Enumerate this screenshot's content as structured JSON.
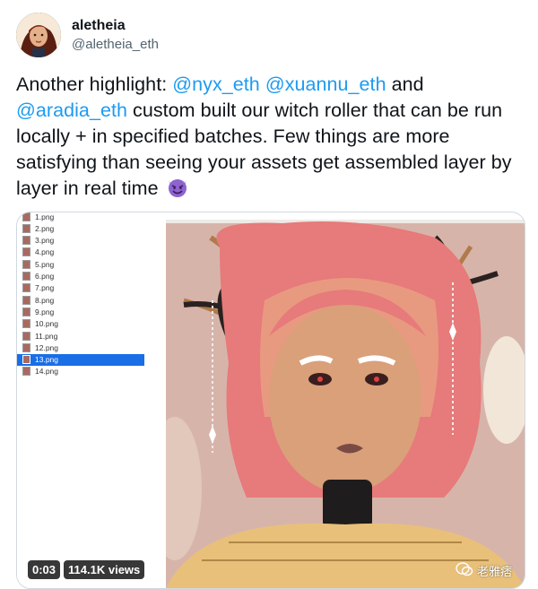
{
  "tweet": {
    "display_name": "aletheia",
    "handle": "@aletheia_eth",
    "text_parts": {
      "p1": "Another highlight: ",
      "m1": "@nyx_eth",
      "p2": " ",
      "m2": "@xuannu_eth",
      "p3": " and ",
      "m3": "@aradia_eth",
      "p4": " custom built our witch roller that can be run locally + in specified batches. Few things are more satisfying than seeing your assets get assembled layer by layer in real time"
    },
    "emoji": "smiling-devil-emoji"
  },
  "media": {
    "files": [
      "1.png",
      "2.png",
      "3.png",
      "4.png",
      "5.png",
      "6.png",
      "7.png",
      "8.png",
      "9.png",
      "10.png",
      "11.png",
      "12.png",
      "13.png",
      "14.png"
    ],
    "selected_file": "13.png",
    "time": "0:03",
    "views": "114.1K views",
    "watermark": "老雅痞"
  },
  "colors": {
    "mention": "#1d9bf0",
    "selection": "#1a6ee6",
    "hair": "#e77a7a",
    "skin": "#d9a07a",
    "background_art": "#d7b4aa"
  }
}
